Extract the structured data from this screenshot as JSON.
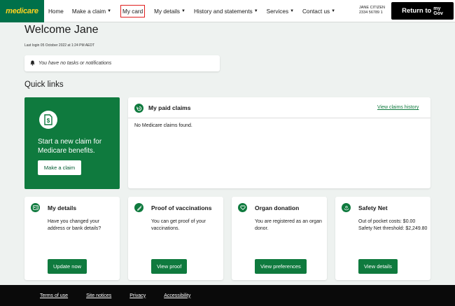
{
  "header": {
    "logo": "medicare",
    "nav": [
      {
        "label": "Home",
        "caret": false
      },
      {
        "label": "Make a claim",
        "caret": true
      },
      {
        "label": "My card",
        "caret": false
      },
      {
        "label": "My details",
        "caret": true
      },
      {
        "label": "History and statements",
        "caret": true
      },
      {
        "label": "Services",
        "caret": true
      },
      {
        "label": "Contact us",
        "caret": true
      }
    ],
    "user_name": "JANE CITIZEN",
    "user_number": "2334 56789 1",
    "return_label": "Return to",
    "mygov_top": "my",
    "mygov_bottom": "Gov"
  },
  "welcome": {
    "title": "Welcome Jane",
    "last_login": "Last login 05 October 2022 at 1:24 PM AEDT",
    "notification": "You have no tasks or notifications"
  },
  "quick_links": {
    "heading": "Quick links",
    "claim_card": {
      "text": "Start a new claim for Medicare benefits.",
      "button": "Make a claim"
    },
    "paid_claims": {
      "title": "My paid claims",
      "link": "View claims history",
      "empty": "No Medicare claims found."
    },
    "cards": [
      {
        "title": "My details",
        "text": "Have you changed your address or bank details?",
        "button": "Update now",
        "icon": "id-card-icon"
      },
      {
        "title": "Proof of vaccinations",
        "text": "You can get proof of your vaccinations.",
        "button": "View proof",
        "icon": "syringe-icon"
      },
      {
        "title": "Organ donation",
        "text": "You are registered as an organ donor.",
        "button": "View preferences",
        "icon": "heart-icon"
      },
      {
        "title": "Safety Net",
        "text": "Out of pocket costs: $0.00 Safety Net threshold: $2,249.80",
        "button": "View details",
        "icon": "hands-icon"
      }
    ]
  },
  "footer": {
    "links": [
      "Terms of use",
      "Site notices",
      "Privacy",
      "Accessibility"
    ]
  },
  "colors": {
    "brand_green": "#0f7a3e",
    "logo_yellow": "#ffd21f",
    "highlight_red": "#e0201f"
  }
}
